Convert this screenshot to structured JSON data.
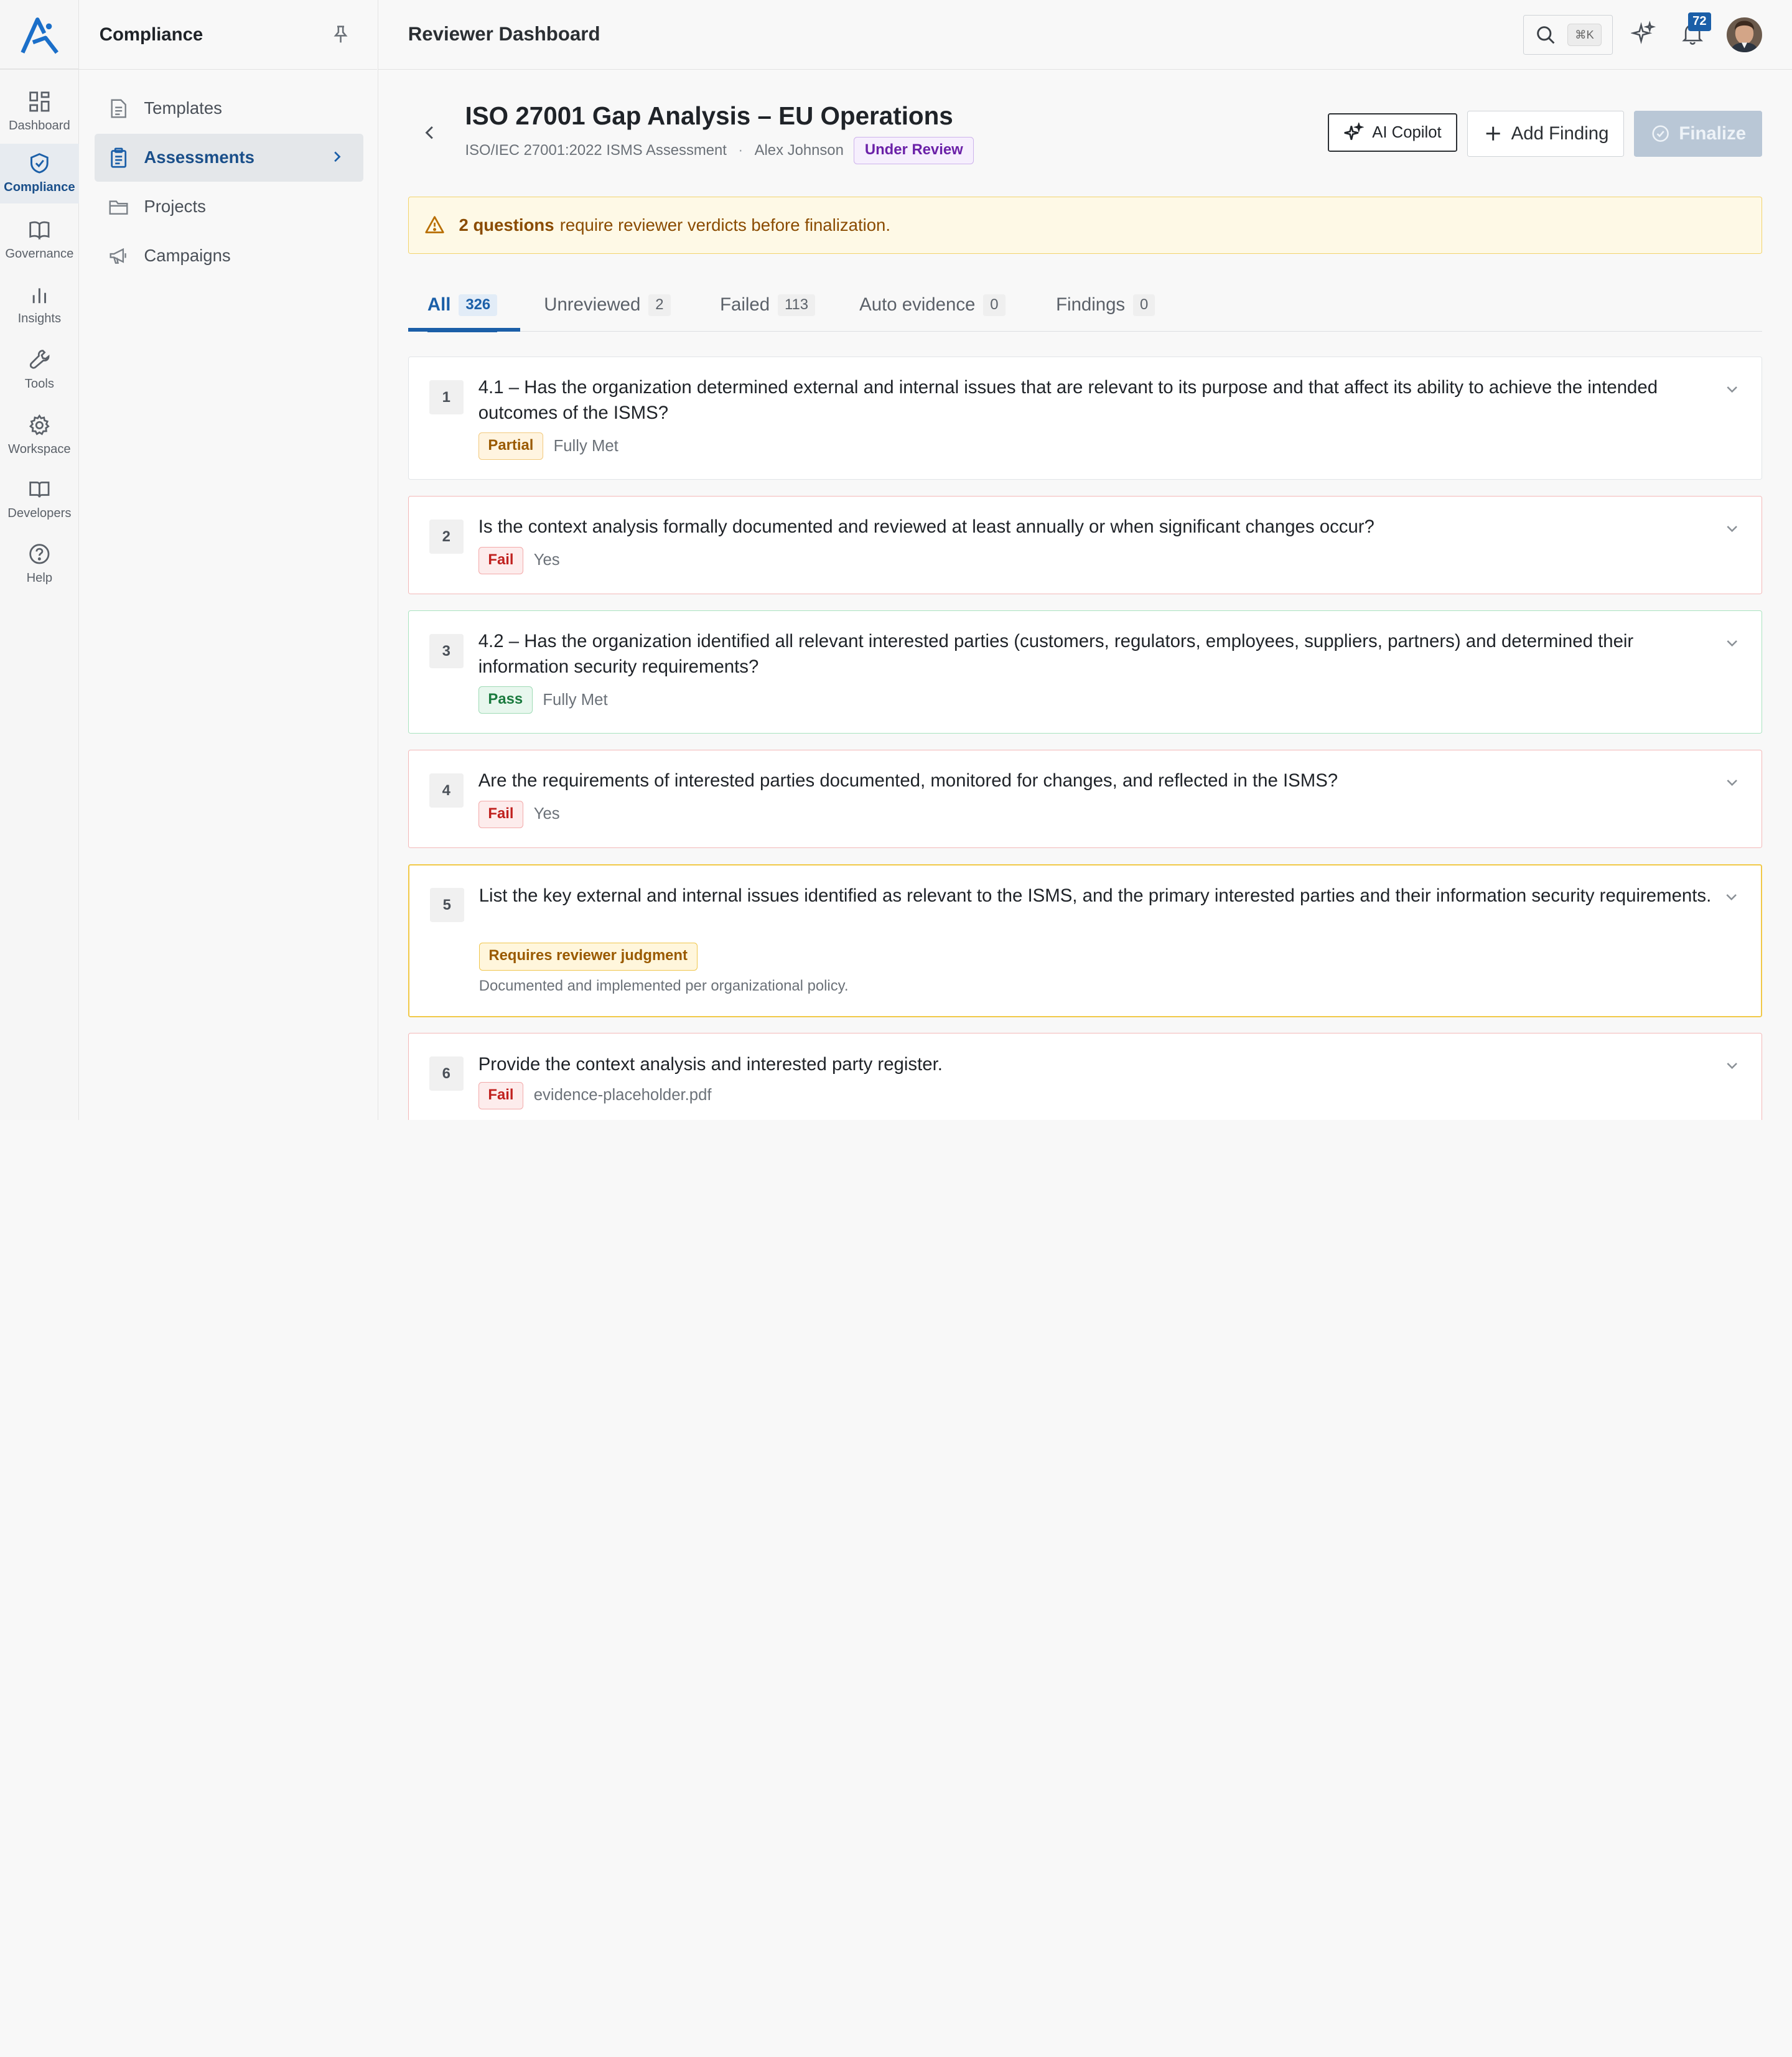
{
  "rail": {
    "items": [
      {
        "label": "Dashboard",
        "icon": "grid-icon"
      },
      {
        "label": "Compliance",
        "icon": "shield-check-icon"
      },
      {
        "label": "Governance",
        "icon": "book-icon"
      },
      {
        "label": "Insights",
        "icon": "bar-chart-icon"
      },
      {
        "label": "Tools",
        "icon": "wrench-icon"
      },
      {
        "label": "Workspace",
        "icon": "gear-icon"
      },
      {
        "label": "Developers",
        "icon": "book-open-icon"
      },
      {
        "label": "Help",
        "icon": "help-circle-icon"
      }
    ],
    "active": "Compliance"
  },
  "subnav": {
    "title": "Compliance",
    "items": [
      {
        "label": "Templates",
        "icon": "document-icon"
      },
      {
        "label": "Assessments",
        "icon": "clipboard-icon"
      },
      {
        "label": "Projects",
        "icon": "folder-icon"
      },
      {
        "label": "Campaigns",
        "icon": "megaphone-icon"
      }
    ],
    "active": "Assessments"
  },
  "header": {
    "title": "Reviewer Dashboard",
    "search_shortcut": "⌘K",
    "notification_count": "72"
  },
  "assessment": {
    "title": "ISO 27001 Gap Analysis – EU Operations",
    "framework": "ISO/IEC 27001:2022 ISMS Assessment",
    "separator": "·",
    "owner": "Alex Johnson",
    "status": "Under Review"
  },
  "actions": {
    "copilot": "AI Copilot",
    "add_finding": "Add Finding",
    "finalize": "Finalize"
  },
  "alert": {
    "count_text": "2 questions",
    "message": "require reviewer verdicts before finalization."
  },
  "tabs": [
    {
      "label": "All",
      "count": "326"
    },
    {
      "label": "Unreviewed",
      "count": "2"
    },
    {
      "label": "Failed",
      "count": "113"
    },
    {
      "label": "Auto evidence",
      "count": "0"
    },
    {
      "label": "Findings",
      "count": "0"
    }
  ],
  "questions": [
    {
      "number": "1",
      "text": "4.1 – Has the organization determined external and internal issues that are relevant to its purpose and that affect its ability to achieve the intended outcomes of the ISMS?",
      "verdict": "Partial",
      "answer": "Fully Met"
    },
    {
      "number": "2",
      "text": "Is the context analysis formally documented and reviewed at least annually or when significant changes occur?",
      "verdict": "Fail",
      "answer": "Yes"
    },
    {
      "number": "3",
      "text": "4.2 – Has the organization identified all relevant interested parties (customers, regulators, employees, suppliers, partners) and determined their information security requirements?",
      "verdict": "Pass",
      "answer": "Fully Met"
    },
    {
      "number": "4",
      "text": "Are the requirements of interested parties documented, monitored for changes, and reflected in the ISMS?",
      "verdict": "Fail",
      "answer": "Yes"
    },
    {
      "number": "5",
      "text": "List the key external and internal issues identified as relevant to the ISMS, and the primary interested parties and their information security requirements.",
      "verdict": "Requires reviewer judgment",
      "answer": "Documented and implemented per organizational policy."
    },
    {
      "number": "6",
      "text": "Provide the context analysis and interested party register.",
      "verdict": "Fail",
      "answer": "evidence-placeholder.pdf"
    }
  ],
  "colors": {
    "accent": "#1b5fa8",
    "fail": "#c0211f",
    "pass": "#1a7a3e",
    "warning": "#9a5a00",
    "status_purple": "#6b21a8"
  }
}
